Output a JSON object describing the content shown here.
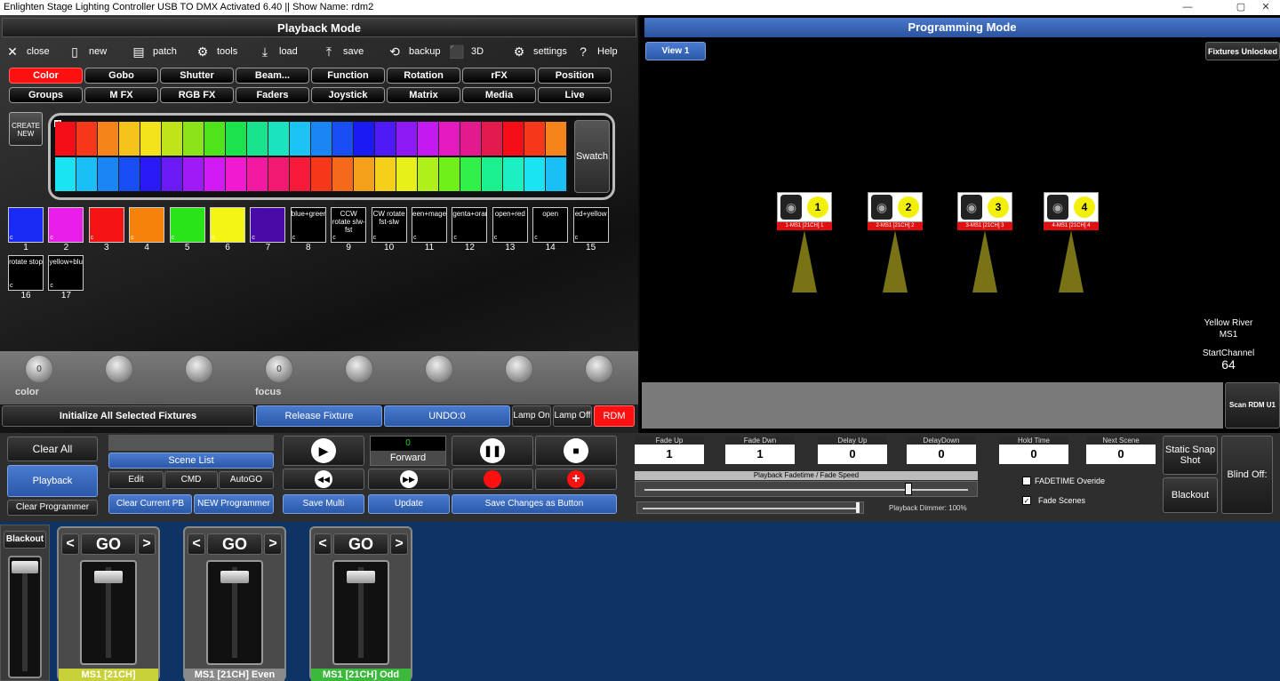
{
  "window": {
    "title": "Enlighten Stage Lighting Controller USB TO DMX Activated 6.40 || Show Name: rdm2",
    "min": "—",
    "max": "▢",
    "close": "✕"
  },
  "playback": {
    "title": "Playback Mode"
  },
  "programming": {
    "title": "Programming Mode",
    "view_tab": "View 1",
    "fixtures_status": "Fixtures Unlocked"
  },
  "toolbar": [
    {
      "icon": "close-icon",
      "glyph": "✕",
      "label": "close"
    },
    {
      "icon": "new-icon",
      "glyph": "▯",
      "label": "new"
    },
    {
      "icon": "patch-icon",
      "glyph": "▤",
      "label": "patch"
    },
    {
      "icon": "tools-icon",
      "glyph": "⚙",
      "label": "tools"
    },
    {
      "icon": "load-icon",
      "glyph": "⤓",
      "label": "load"
    },
    {
      "icon": "save-icon",
      "glyph": "⤒",
      "label": "save"
    },
    {
      "icon": "backup-icon",
      "glyph": "⟲",
      "label": "backup"
    },
    {
      "icon": "cube-icon",
      "glyph": "⬛",
      "label": "3D"
    },
    {
      "icon": "gear-icon",
      "glyph": "⚙",
      "label": "settings"
    },
    {
      "icon": "help-icon",
      "glyph": "?",
      "label": "Help"
    }
  ],
  "tabs_row1": [
    "Color",
    "Gobo",
    "Shutter",
    "Beam...",
    "Function",
    "Rotation",
    "rFX",
    "Position"
  ],
  "tabs_row2": [
    "Groups",
    "M FX",
    "RGB FX",
    "Faders",
    "Joystick",
    "Matrix",
    "Media",
    "Live"
  ],
  "create_new": "CREATE NEW",
  "swatch_label": "Swatch",
  "palette_top": [
    "#f50e17",
    "#f5381a",
    "#f5851a",
    "#f5c31a",
    "#f2e31a",
    "#c0e31a",
    "#8de31a",
    "#4ee31a",
    "#1ae34e",
    "#1ae38d",
    "#1ae3c0",
    "#1ac3f2",
    "#1a85f5",
    "#1a4ef5",
    "#1a1af5",
    "#4e1af5",
    "#8d1af5",
    "#c31af2",
    "#e31ac0",
    "#e31a8d",
    "#e31a4e"
  ],
  "palette_bottom": [
    "#1ae3f2",
    "#1ac0f5",
    "#1a85f5",
    "#1a4ef5",
    "#2a1af5",
    "#6a1af5",
    "#a01af5",
    "#d21af2",
    "#f21ad0",
    "#f21aa0",
    "#f21a70",
    "#f51a3a",
    "#f5381a",
    "#f56a1a",
    "#f5a01a",
    "#f5d01a",
    "#e8f01a",
    "#b0f01a",
    "#70f01a",
    "#30f04a",
    "#1af08d",
    "#1af0c0"
  ],
  "tiles": [
    {
      "n": "1",
      "color": "#1a2af5",
      "label": ""
    },
    {
      "n": "2",
      "color": "#e91ee9",
      "label": ""
    },
    {
      "n": "3",
      "color": "#f51414",
      "label": ""
    },
    {
      "n": "4",
      "color": "#f5820a",
      "label": ""
    },
    {
      "n": "5",
      "color": "#2ae41a",
      "label": ""
    },
    {
      "n": "6",
      "color": "#f5f514",
      "label": ""
    },
    {
      "n": "7",
      "color": "#4a0aa8",
      "label": ""
    },
    {
      "n": "8",
      "color": "#000000",
      "label": "blue+green"
    },
    {
      "n": "9",
      "color": "#000000",
      "label": "CCW rotate slw-fst"
    },
    {
      "n": "10",
      "color": "#000000",
      "label": "CW rotate fst-slw"
    },
    {
      "n": "11",
      "color": "#000000",
      "label": "een+magen"
    },
    {
      "n": "12",
      "color": "#000000",
      "label": "genta+oran"
    },
    {
      "n": "13",
      "color": "#000000",
      "label": "open+red"
    },
    {
      "n": "14",
      "color": "#000000",
      "label": "open"
    },
    {
      "n": "15",
      "color": "#000000",
      "label": "ed+yellow"
    },
    {
      "n": "16",
      "color": "#000000",
      "label": "rotate stop"
    },
    {
      "n": "17",
      "color": "#000000",
      "label": "yellow+blue"
    }
  ],
  "tile_corner": "c",
  "knobs": [
    {
      "value": "0",
      "label": "color"
    },
    {
      "value": "",
      "label": ""
    },
    {
      "value": "",
      "label": ""
    },
    {
      "value": "0",
      "label": "focus"
    },
    {
      "value": "",
      "label": ""
    },
    {
      "value": "",
      "label": ""
    },
    {
      "value": "",
      "label": ""
    },
    {
      "value": "",
      "label": ""
    }
  ],
  "bottombar": {
    "init": "Initialize All Selected Fixtures",
    "release": "Release Fixture",
    "undo": "UNDO:0",
    "lamp_on": "Lamp On",
    "lamp_off": "Lamp Off",
    "rdm": "RDM"
  },
  "fixtures": [
    {
      "num": "1",
      "label": "1-MS1 [21CH] 1"
    },
    {
      "num": "2",
      "label": "2-MS1 [21CH] 2"
    },
    {
      "num": "3",
      "label": "3-MS1 [21CH] 3"
    },
    {
      "num": "4",
      "label": "4-MS1 [21CH] 4"
    }
  ],
  "fixture_info": {
    "maker": "Yellow River",
    "model": "MS1",
    "start_label": "StartChannel",
    "start": "64"
  },
  "scan_rdm": "Scan RDM U1",
  "controls": {
    "clear_all": "Clear All",
    "playback": "Playback",
    "clear_programmer": "Clear Programmer",
    "scene_list": "Scene List",
    "edit": "Edit",
    "cmd": "CMD",
    "autogo": "AutoGO",
    "clear_current_pb": "Clear Current PB",
    "new_programmer": "NEW Programmer",
    "save_multi": "Save Multi",
    "update": "Update",
    "save_changes": "Save Changes as Button",
    "counter": "0",
    "direction": "Forward"
  },
  "params": [
    {
      "label": "Fade Up",
      "value": "1"
    },
    {
      "label": "Fade Dwn",
      "value": "1"
    },
    {
      "label": "Delay Up",
      "value": "0"
    },
    {
      "label": "DelayDown",
      "value": "0"
    },
    {
      "label": "Hold Time",
      "value": "0"
    },
    {
      "label": "Next Scene",
      "value": "0"
    }
  ],
  "fade_speed_label": "Playback Fadetime / Fade Speed",
  "dimmer_label": "Playback Dimmer: 100%",
  "fadetime_override": {
    "label": "FADETIME Overide",
    "checked": false
  },
  "fade_scenes": {
    "label": "Fade Scenes",
    "checked": true
  },
  "right_buttons": {
    "static_snap": "Static Snap Shot",
    "blackout": "Blackout",
    "blind": "Blind Off:"
  },
  "playbacks": [
    {
      "name": "MS1 [21CH]",
      "color": "#c8d03a"
    },
    {
      "name": "MS1 [21CH] Even",
      "color": "#8a8a8a"
    },
    {
      "name": "MS1 [21CH] Odd",
      "color": "#3cb83c"
    }
  ],
  "go_label": "GO",
  "prev": "<",
  "next": ">",
  "master_blackout": "Blackout"
}
